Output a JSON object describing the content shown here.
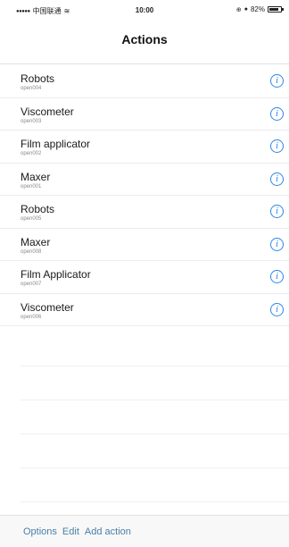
{
  "status_bar": {
    "carrier": "中国联通",
    "time": "10:00",
    "battery": "82%",
    "icons": [
      "signal-dots-icon",
      "wifi-icon",
      "location-icon",
      "alarm-icon",
      "battery-icon"
    ]
  },
  "nav": {
    "title": "Actions"
  },
  "actions": [
    {
      "title": "Robots",
      "subtitle": "open004"
    },
    {
      "title": "Viscometer",
      "subtitle": "open003"
    },
    {
      "title": "Film applicator",
      "subtitle": "open002"
    },
    {
      "title": "Maxer",
      "subtitle": "open001"
    },
    {
      "title": "Robots",
      "subtitle": "open005"
    },
    {
      "title": "Maxer",
      "subtitle": "open008"
    },
    {
      "title": "Film Applicator",
      "subtitle": "open007"
    },
    {
      "title": "Viscometer",
      "subtitle": "open006"
    }
  ],
  "info_glyph": "i",
  "toolbar": {
    "options_label": "Options",
    "edit_label": "Edit",
    "add_label": "Add action"
  },
  "colors": {
    "accent": "#2f86e8",
    "toolbar_text": "#4a7fa9"
  }
}
